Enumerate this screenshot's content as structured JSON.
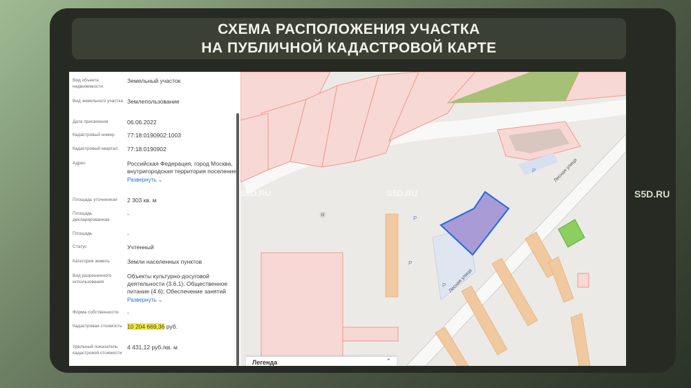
{
  "slide": {
    "title_line1": "СХЕМА РАСПОЛОЖЕНИЯ УЧАСТКА",
    "title_line2": "НА ПУБЛИЧНОЙ КАДАСТРОВОЙ КАРТЕ",
    "site_mark": "S5D.RU"
  },
  "panel": {
    "rows": [
      {
        "label": "Вид объекта недвижимости",
        "value": "Земельный участок"
      },
      {
        "label": "Вид земельного участка",
        "value": "Землепользование"
      },
      {
        "label": "Дата присвоения",
        "value": "06.06.2022"
      },
      {
        "label": "Кадастровый номер",
        "value": "77:18:0190902:1003"
      },
      {
        "label": "Кадастровый квартал",
        "value": "77:18:0190902"
      },
      {
        "label": "Адрес",
        "value": "Российская Федерация, город Москва, внутригородская территория поселение",
        "link": "Развернуть"
      },
      {
        "label": "Площадь уточненная",
        "value": "2 303 кв. м"
      },
      {
        "label": "Площадь декларированная",
        "value": "-"
      },
      {
        "label": "Площадь",
        "value": "-"
      },
      {
        "label": "Статус",
        "value": "Учтенный"
      },
      {
        "label": "Категория земель",
        "value": "Земли населенных пунктов"
      },
      {
        "label": "Вид разрешенного использования",
        "value": "Объекты культурно-досуговой деятельности (3.6.1); Общественное питание (4.6); Обеспечение занятий",
        "link": "Развернуть"
      },
      {
        "label": "Форма собственности",
        "value": "-"
      },
      {
        "label": "Кадастровая стоимость",
        "value_highlight": "10 204 669,36",
        "value_rest": " руб."
      },
      {
        "label": "Удельный показатель кадастровой стоимости",
        "value": "4 431,12 руб./кв. м"
      }
    ]
  },
  "map": {
    "street_label_1": "Лесная улица",
    "street_label_2": "Лесная улица",
    "parking": "P",
    "watermark": "S5D.RU",
    "legend_title": "Легенда",
    "legend_toggle": "⌃",
    "colors": {
      "selected_fill": "#a99bd6",
      "selected_stroke": "#2a6de0",
      "green": "#8ccf5f",
      "parcel": "#f7d8d5",
      "parcel_edge": "#ef9a90",
      "building": "#f0c9a0"
    }
  }
}
